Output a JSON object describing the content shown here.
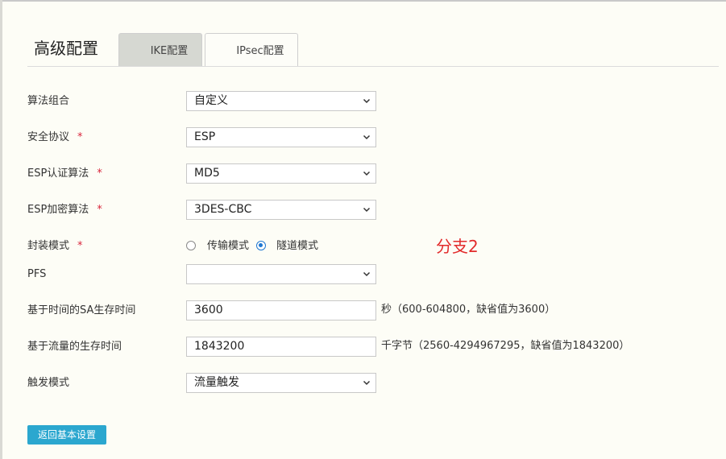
{
  "header": {
    "title": "高级配置",
    "tabs": [
      {
        "label": "IKE配置",
        "active": true
      },
      {
        "label": "IPsec配置",
        "active": false
      }
    ]
  },
  "form": {
    "required_mark": "*",
    "algorithm_combo": {
      "label": "算法组合",
      "value": "自定义"
    },
    "security_protocol": {
      "label": "安全协议",
      "value": "ESP"
    },
    "esp_auth_algorithm": {
      "label": "ESP认证算法",
      "value": "MD5"
    },
    "esp_encrypt_algorithm": {
      "label": "ESP加密算法",
      "value": "3DES-CBC"
    },
    "encapsulation_mode": {
      "label": "封装模式",
      "options": [
        {
          "label": "传输模式",
          "selected": false
        },
        {
          "label": "隧道模式",
          "selected": true
        }
      ]
    },
    "pfs": {
      "label": "PFS",
      "value": ""
    },
    "time_sa_lifetime": {
      "label": "基于时间的SA生存时间",
      "value": "3600",
      "hint": "秒（600-604800，缺省值为3600）"
    },
    "traffic_lifetime": {
      "label": "基于流量的生存时间",
      "value": "1843200",
      "hint": "千字节（2560-4294967295，缺省值为1843200）"
    },
    "trigger_mode": {
      "label": "触发模式",
      "value": "流量触发"
    }
  },
  "annotation": "分支2",
  "buttons": {
    "back_label": "返回基本设置"
  },
  "colors": {
    "accent_button": "#2ba7cf",
    "required": "#d9263c",
    "annotation": "#e22b2b",
    "radio_selected": "#1f78d1"
  }
}
